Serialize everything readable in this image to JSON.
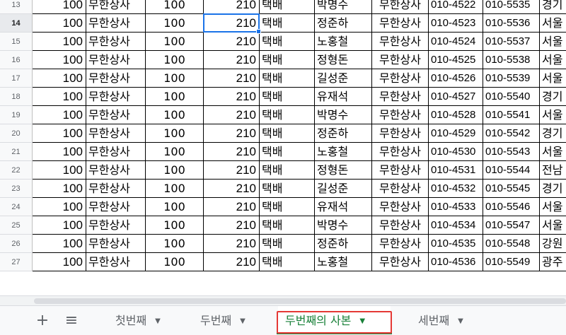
{
  "sheet": {
    "rows": [
      {
        "num": "13",
        "c1": "100",
        "c2": "무한상사",
        "c3": "100",
        "c4": "210",
        "c5": "택배",
        "c6": "박명수",
        "c7": "무한상사",
        "c8": "010-4522",
        "c9": "010-5535",
        "c10": "경기"
      },
      {
        "num": "14",
        "c1": "100",
        "c2": "무한상사",
        "c3": "100",
        "c4": "210",
        "c5": "택배",
        "c6": "정준하",
        "c7": "무한상사",
        "c8": "010-4523",
        "c9": "010-5536",
        "c10": "서울"
      },
      {
        "num": "15",
        "c1": "100",
        "c2": "무한상사",
        "c3": "100",
        "c4": "210",
        "c5": "택배",
        "c6": "노홍철",
        "c7": "무한상사",
        "c8": "010-4524",
        "c9": "010-5537",
        "c10": "서울"
      },
      {
        "num": "16",
        "c1": "100",
        "c2": "무한상사",
        "c3": "100",
        "c4": "210",
        "c5": "택배",
        "c6": "정형돈",
        "c7": "무한상사",
        "c8": "010-4525",
        "c9": "010-5538",
        "c10": "서울"
      },
      {
        "num": "17",
        "c1": "100",
        "c2": "무한상사",
        "c3": "100",
        "c4": "210",
        "c5": "택배",
        "c6": "길성준",
        "c7": "무한상사",
        "c8": "010-4526",
        "c9": "010-5539",
        "c10": "서울"
      },
      {
        "num": "18",
        "c1": "100",
        "c2": "무한상사",
        "c3": "100",
        "c4": "210",
        "c5": "택배",
        "c6": "유재석",
        "c7": "무한상사",
        "c8": "010-4527",
        "c9": "010-5540",
        "c10": "경기"
      },
      {
        "num": "19",
        "c1": "100",
        "c2": "무한상사",
        "c3": "100",
        "c4": "210",
        "c5": "택배",
        "c6": "박명수",
        "c7": "무한상사",
        "c8": "010-4528",
        "c9": "010-5541",
        "c10": "서울"
      },
      {
        "num": "20",
        "c1": "100",
        "c2": "무한상사",
        "c3": "100",
        "c4": "210",
        "c5": "택배",
        "c6": "정준하",
        "c7": "무한상사",
        "c8": "010-4529",
        "c9": "010-5542",
        "c10": "경기"
      },
      {
        "num": "21",
        "c1": "100",
        "c2": "무한상사",
        "c3": "100",
        "c4": "210",
        "c5": "택배",
        "c6": "노홍철",
        "c7": "무한상사",
        "c8": "010-4530",
        "c9": "010-5543",
        "c10": "서울"
      },
      {
        "num": "22",
        "c1": "100",
        "c2": "무한상사",
        "c3": "100",
        "c4": "210",
        "c5": "택배",
        "c6": "정형돈",
        "c7": "무한상사",
        "c8": "010-4531",
        "c9": "010-5544",
        "c10": "전남"
      },
      {
        "num": "23",
        "c1": "100",
        "c2": "무한상사",
        "c3": "100",
        "c4": "210",
        "c5": "택배",
        "c6": "길성준",
        "c7": "무한상사",
        "c8": "010-4532",
        "c9": "010-5545",
        "c10": "경기"
      },
      {
        "num": "24",
        "c1": "100",
        "c2": "무한상사",
        "c3": "100",
        "c4": "210",
        "c5": "택배",
        "c6": "유재석",
        "c7": "무한상사",
        "c8": "010-4533",
        "c9": "010-5546",
        "c10": "서울"
      },
      {
        "num": "25",
        "c1": "100",
        "c2": "무한상사",
        "c3": "100",
        "c4": "210",
        "c5": "택배",
        "c6": "박명수",
        "c7": "무한상사",
        "c8": "010-4534",
        "c9": "010-5547",
        "c10": "서울"
      },
      {
        "num": "26",
        "c1": "100",
        "c2": "무한상사",
        "c3": "100",
        "c4": "210",
        "c5": "택배",
        "c6": "정준하",
        "c7": "무한상사",
        "c8": "010-4535",
        "c9": "010-5548",
        "c10": "강원"
      },
      {
        "num": "27",
        "c1": "100",
        "c2": "무한상사",
        "c3": "100",
        "c4": "210",
        "c5": "택배",
        "c6": "노홍철",
        "c7": "무한상사",
        "c8": "010-4536",
        "c9": "010-5549",
        "c10": "광주"
      }
    ],
    "active_row": "14"
  },
  "tabbar": {
    "add_icon": "plus-icon",
    "add_glyph": "+",
    "menu_icon": "list-icon",
    "menu_glyph": "≡",
    "tabs": [
      {
        "label": "첫번째",
        "active": false
      },
      {
        "label": "두번째",
        "active": false
      },
      {
        "label": "두번째의 사본",
        "active": true
      },
      {
        "label": "세번째",
        "active": false
      }
    ],
    "caret_glyph": "▼"
  },
  "colors": {
    "selection": "#1a73e8",
    "active_tab": "#188038",
    "highlight_box": "#e53935"
  }
}
